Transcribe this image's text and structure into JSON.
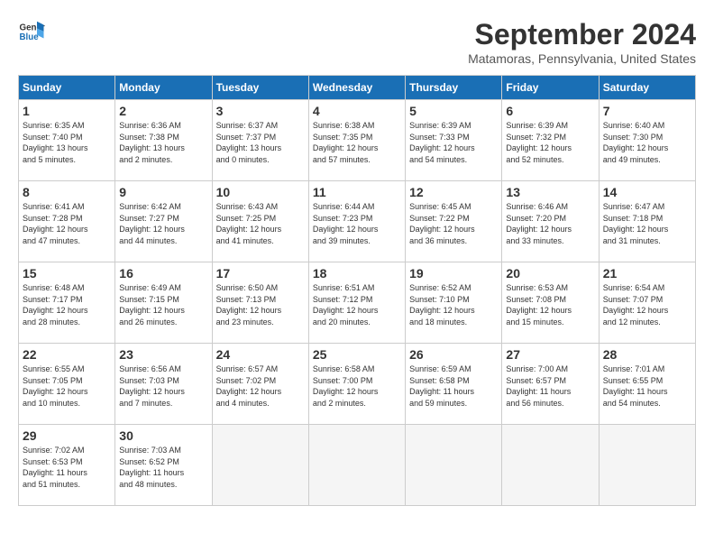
{
  "logo": {
    "line1": "General",
    "line2": "Blue"
  },
  "title": "September 2024",
  "location": "Matamoras, Pennsylvania, United States",
  "weekdays": [
    "Sunday",
    "Monday",
    "Tuesday",
    "Wednesday",
    "Thursday",
    "Friday",
    "Saturday"
  ],
  "days": [
    {
      "num": "",
      "info": ""
    },
    {
      "num": "1",
      "info": "Sunrise: 6:35 AM\nSunset: 7:40 PM\nDaylight: 13 hours\nand 5 minutes."
    },
    {
      "num": "2",
      "info": "Sunrise: 6:36 AM\nSunset: 7:38 PM\nDaylight: 13 hours\nand 2 minutes."
    },
    {
      "num": "3",
      "info": "Sunrise: 6:37 AM\nSunset: 7:37 PM\nDaylight: 13 hours\nand 0 minutes."
    },
    {
      "num": "4",
      "info": "Sunrise: 6:38 AM\nSunset: 7:35 PM\nDaylight: 12 hours\nand 57 minutes."
    },
    {
      "num": "5",
      "info": "Sunrise: 6:39 AM\nSunset: 7:33 PM\nDaylight: 12 hours\nand 54 minutes."
    },
    {
      "num": "6",
      "info": "Sunrise: 6:39 AM\nSunset: 7:32 PM\nDaylight: 12 hours\nand 52 minutes."
    },
    {
      "num": "7",
      "info": "Sunrise: 6:40 AM\nSunset: 7:30 PM\nDaylight: 12 hours\nand 49 minutes."
    },
    {
      "num": "8",
      "info": "Sunrise: 6:41 AM\nSunset: 7:28 PM\nDaylight: 12 hours\nand 47 minutes."
    },
    {
      "num": "9",
      "info": "Sunrise: 6:42 AM\nSunset: 7:27 PM\nDaylight: 12 hours\nand 44 minutes."
    },
    {
      "num": "10",
      "info": "Sunrise: 6:43 AM\nSunset: 7:25 PM\nDaylight: 12 hours\nand 41 minutes."
    },
    {
      "num": "11",
      "info": "Sunrise: 6:44 AM\nSunset: 7:23 PM\nDaylight: 12 hours\nand 39 minutes."
    },
    {
      "num": "12",
      "info": "Sunrise: 6:45 AM\nSunset: 7:22 PM\nDaylight: 12 hours\nand 36 minutes."
    },
    {
      "num": "13",
      "info": "Sunrise: 6:46 AM\nSunset: 7:20 PM\nDaylight: 12 hours\nand 33 minutes."
    },
    {
      "num": "14",
      "info": "Sunrise: 6:47 AM\nSunset: 7:18 PM\nDaylight: 12 hours\nand 31 minutes."
    },
    {
      "num": "15",
      "info": "Sunrise: 6:48 AM\nSunset: 7:17 PM\nDaylight: 12 hours\nand 28 minutes."
    },
    {
      "num": "16",
      "info": "Sunrise: 6:49 AM\nSunset: 7:15 PM\nDaylight: 12 hours\nand 26 minutes."
    },
    {
      "num": "17",
      "info": "Sunrise: 6:50 AM\nSunset: 7:13 PM\nDaylight: 12 hours\nand 23 minutes."
    },
    {
      "num": "18",
      "info": "Sunrise: 6:51 AM\nSunset: 7:12 PM\nDaylight: 12 hours\nand 20 minutes."
    },
    {
      "num": "19",
      "info": "Sunrise: 6:52 AM\nSunset: 7:10 PM\nDaylight: 12 hours\nand 18 minutes."
    },
    {
      "num": "20",
      "info": "Sunrise: 6:53 AM\nSunset: 7:08 PM\nDaylight: 12 hours\nand 15 minutes."
    },
    {
      "num": "21",
      "info": "Sunrise: 6:54 AM\nSunset: 7:07 PM\nDaylight: 12 hours\nand 12 minutes."
    },
    {
      "num": "22",
      "info": "Sunrise: 6:55 AM\nSunset: 7:05 PM\nDaylight: 12 hours\nand 10 minutes."
    },
    {
      "num": "23",
      "info": "Sunrise: 6:56 AM\nSunset: 7:03 PM\nDaylight: 12 hours\nand 7 minutes."
    },
    {
      "num": "24",
      "info": "Sunrise: 6:57 AM\nSunset: 7:02 PM\nDaylight: 12 hours\nand 4 minutes."
    },
    {
      "num": "25",
      "info": "Sunrise: 6:58 AM\nSunset: 7:00 PM\nDaylight: 12 hours\nand 2 minutes."
    },
    {
      "num": "26",
      "info": "Sunrise: 6:59 AM\nSunset: 6:58 PM\nDaylight: 11 hours\nand 59 minutes."
    },
    {
      "num": "27",
      "info": "Sunrise: 7:00 AM\nSunset: 6:57 PM\nDaylight: 11 hours\nand 56 minutes."
    },
    {
      "num": "28",
      "info": "Sunrise: 7:01 AM\nSunset: 6:55 PM\nDaylight: 11 hours\nand 54 minutes."
    },
    {
      "num": "29",
      "info": "Sunrise: 7:02 AM\nSunset: 6:53 PM\nDaylight: 11 hours\nand 51 minutes."
    },
    {
      "num": "30",
      "info": "Sunrise: 7:03 AM\nSunset: 6:52 PM\nDaylight: 11 hours\nand 48 minutes."
    },
    {
      "num": "",
      "info": ""
    },
    {
      "num": "",
      "info": ""
    },
    {
      "num": "",
      "info": ""
    },
    {
      "num": "",
      "info": ""
    }
  ]
}
